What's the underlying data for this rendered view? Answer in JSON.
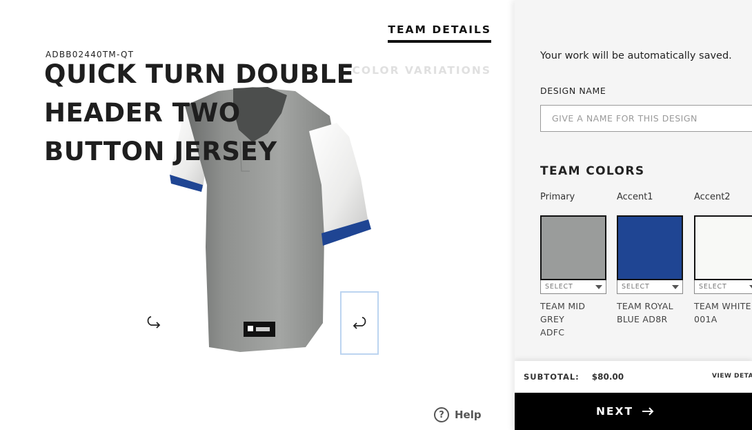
{
  "product": {
    "sku": "ADBB02440TM-QT",
    "title_lines": [
      "QUICK TURN DOUBLE",
      "HEADER TWO",
      "BUTTON JERSEY"
    ]
  },
  "tabs": {
    "details": "TEAM DETAILS",
    "variations": "COLOR VARIATIONS"
  },
  "viewer": {
    "rotate_left_icon": "rotate-left-icon",
    "rotate_right_icon": "rotate-right-icon"
  },
  "help": {
    "label": "Help",
    "icon": "?"
  },
  "panel": {
    "autosave": "Your work will be automatically saved.",
    "design_name_label": "DESIGN NAME",
    "design_name_placeholder": "GIVE A NAME FOR THIS DESIGN",
    "design_name_value": "",
    "team_colors_heading": "TEAM COLORS",
    "swatches": [
      {
        "label": "Primary",
        "color": "#9a9c9b",
        "select": "SELECT",
        "name_line1": "TEAM MID GREY",
        "name_line2": "ADFC"
      },
      {
        "label": "Accent1",
        "color": "#1f4593",
        "select": "SELECT",
        "name_line1": "TEAM ROYAL",
        "name_line2": "BLUE AD8R"
      },
      {
        "label": "Accent2",
        "color": "#f8f9f6",
        "select": "SELECT",
        "name_line1": "TEAM WHITE",
        "name_line2": "001A"
      }
    ]
  },
  "footer": {
    "subtotal_label": "SUBTOTAL:",
    "subtotal_value": "$80.00",
    "view_details": "VIEW DETAILS",
    "next_label": "NEXT",
    "next_icon": "arrow-right-icon"
  }
}
